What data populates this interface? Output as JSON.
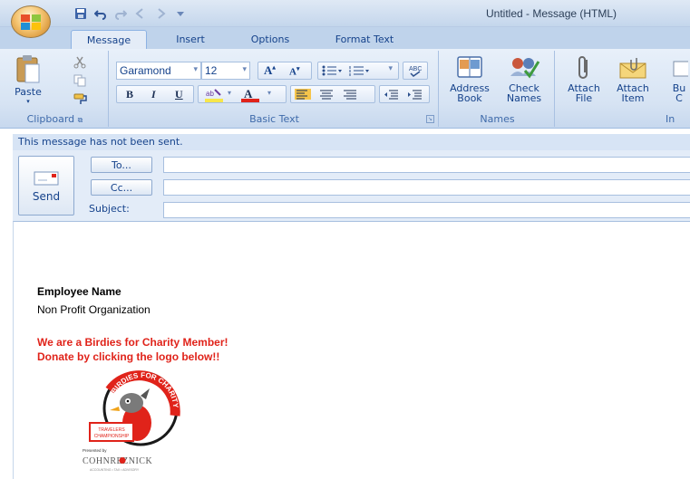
{
  "window": {
    "title": "Untitled - Message (HTML)"
  },
  "tabs": [
    {
      "label": "Message",
      "active": true
    },
    {
      "label": "Insert",
      "active": false
    },
    {
      "label": "Options",
      "active": false
    },
    {
      "label": "Format Text",
      "active": false
    }
  ],
  "ribbon": {
    "clipboard": {
      "label": "Clipboard",
      "paste_label": "Paste"
    },
    "basic_text": {
      "label": "Basic Text",
      "font_name": "Garamond",
      "font_size": "12",
      "bold": "B",
      "italic": "I",
      "underline": "U"
    },
    "names": {
      "label": "Names",
      "address_book_line1": "Address",
      "address_book_line2": "Book",
      "check_names_line1": "Check",
      "check_names_line2": "Names"
    },
    "include": {
      "label": "In",
      "attach_file_line1": "Attach",
      "attach_file_line2": "File",
      "attach_item_line1": "Attach",
      "attach_item_line2": "Item",
      "bu_line1": "Bu",
      "bu_line2": "C"
    }
  },
  "info_bar": "This message has not been sent.",
  "header": {
    "send_label": "Send",
    "to_label": "To...",
    "cc_label": "Cc...",
    "subject_label": "Subject:",
    "to_value": "",
    "cc_value": "",
    "subject_value": ""
  },
  "body": {
    "employee_name": "Employee Name",
    "organization": "Non Profit Organization",
    "member_line": "We are a Birdies for Charity Member!",
    "donate_line": "Donate by clicking the logo below!!",
    "logo": {
      "arc_text": "BIRDIES FOR CHARITY",
      "banner_line1": "TRAVELERS",
      "banner_line2": "CHAMPIONSHIP",
      "presented_by": "Presented by",
      "sponsor": "COHNREZNICK",
      "sponsor_sub": "ACCOUNTING • TAX • ADVISORY"
    }
  },
  "colors": {
    "accent_red": "#e0231a",
    "ribbon_blue": "#15428b"
  }
}
